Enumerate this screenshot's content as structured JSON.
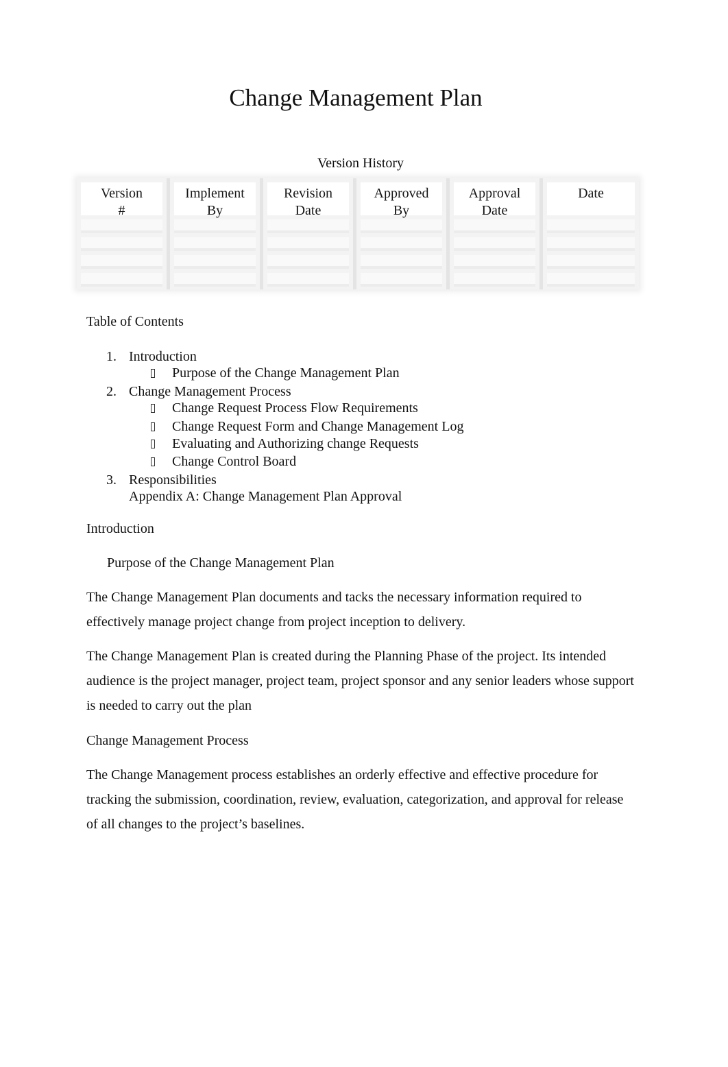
{
  "document": {
    "title": "Change Management Plan",
    "version_history": {
      "title": "Version History",
      "columns": [
        {
          "line1": "Version",
          "line2": "#"
        },
        {
          "line1": "Implement",
          "line2": "By"
        },
        {
          "line1": "Revision",
          "line2": "Date"
        },
        {
          "line1": "Approved",
          "line2": "By"
        },
        {
          "line1": "Approval",
          "line2": "Date"
        },
        {
          "line1": "Date",
          "line2": ""
        }
      ],
      "empty_rows": 4
    },
    "toc": {
      "title": "Table of Contents",
      "items": [
        {
          "num": "1.",
          "label": "Introduction",
          "subitems": [
            "Purpose of the Change Management Plan"
          ]
        },
        {
          "num": "2.",
          "label": "Change Management Process",
          "subitems": [
            "Change Request Process Flow Requirements",
            "Change Request Form and Change Management Log",
            "Evaluating and Authorizing change Requests",
            "Change Control Board"
          ]
        },
        {
          "num": "3.",
          "label": "Responsibilities",
          "subitems": []
        }
      ],
      "appendix": "Appendix A: Change Management Plan Approval"
    },
    "sections": {
      "introduction_heading": "Introduction",
      "purpose_heading": "Purpose of the Change Management Plan",
      "purpose_para1": "The Change Management Plan documents and tacks the necessary information required to effectively manage project change from project inception to delivery.",
      "purpose_para2": "The Change Management Plan is created during the Planning Phase of the project. Its intended audience is the project manager, project team, project sponsor and any senior leaders whose support is needed to carry out the plan",
      "process_heading": "Change Management Process",
      "process_para1": "The Change Management process establishes an orderly effective and effective procedure for tracking the submission, coordination, review, evaluation, categorization, and approval for release of all changes to the project’s baselines."
    }
  }
}
